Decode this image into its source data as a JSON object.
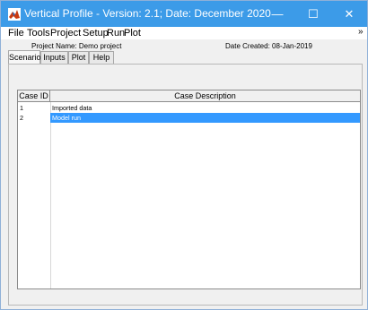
{
  "window": {
    "title": "Vertical Profile - Version: 2.1;  Date: December 2020",
    "minimize_label": "—",
    "maximize_label": "☐",
    "close_label": "✕",
    "app_icon": "matlab-icon"
  },
  "menubar": {
    "items": [
      "File",
      "Tools",
      "Project",
      "Setup",
      "Run",
      "Plot"
    ],
    "overflow": "»"
  },
  "project": {
    "name_label": "Project Name: Demo project",
    "date_label": "Date Created: 08-Jan-2019"
  },
  "tabs": [
    {
      "label": "Scenarios",
      "active": true
    },
    {
      "label": "Inputs",
      "active": false
    },
    {
      "label": "Plot",
      "active": false
    },
    {
      "label": "Help",
      "active": false
    }
  ],
  "table": {
    "headers": [
      "Case ID",
      "Case Description"
    ],
    "rows": [
      {
        "id": "1",
        "description": "Imported data",
        "selected": false
      },
      {
        "id": "2",
        "description": "Model run",
        "selected": true
      }
    ]
  }
}
